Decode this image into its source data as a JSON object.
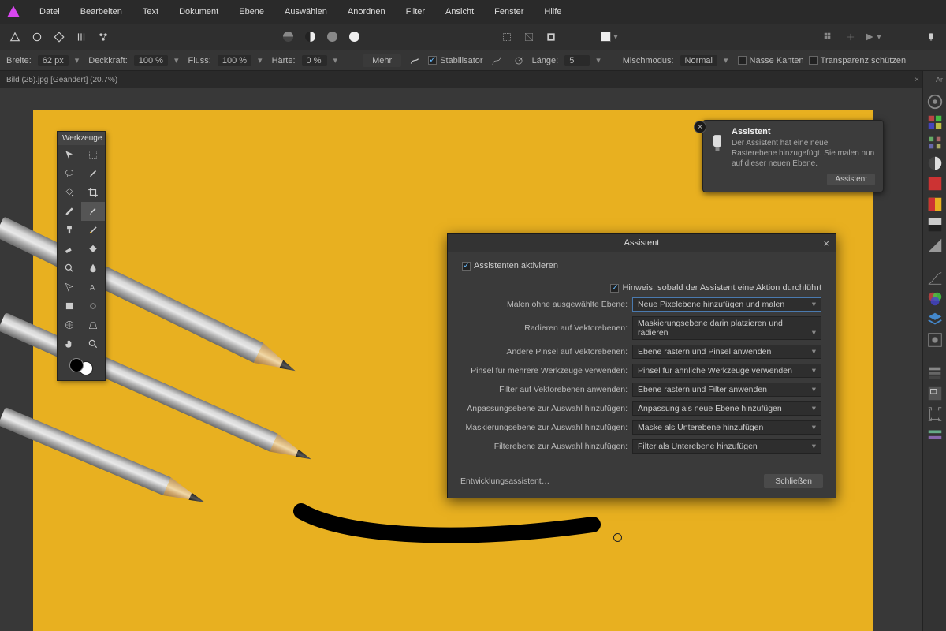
{
  "menubar": {
    "items": [
      "Datei",
      "Bearbeiten",
      "Text",
      "Dokument",
      "Ebene",
      "Auswählen",
      "Anordnen",
      "Filter",
      "Ansicht",
      "Fenster",
      "Hilfe"
    ]
  },
  "optionsbar": {
    "breite_label": "Breite:",
    "breite_value": "62 px",
    "deckkraft_label": "Deckkraft:",
    "deckkraft_value": "100 %",
    "fluss_label": "Fluss:",
    "fluss_value": "100 %",
    "haerte_label": "Härte:",
    "haerte_value": "0 %",
    "mehr_label": "Mehr",
    "stabilisator_label": "Stabilisator",
    "laenge_label": "Länge:",
    "laenge_value": "5",
    "mischmodus_label": "Mischmodus:",
    "mischmodus_value": "Normal",
    "nasse_kanten_label": "Nasse Kanten",
    "transparenz_label": "Transparenz schützen"
  },
  "document": {
    "tab_label": "Bild (25).jpg [Geändert] (20.7%)"
  },
  "tools_panel": {
    "title": "Werkzeuge"
  },
  "notification": {
    "title": "Assistent",
    "body": "Der Assistent hat eine neue Rasterebene hinzugefügt. Sie malen nun auf dieser neuen Ebene.",
    "button": "Assistent"
  },
  "dialog": {
    "title": "Assistent",
    "activate_label": "Assistenten aktivieren",
    "hint_label": "Hinweis, sobald der Assistent eine Aktion durchführt",
    "rows": [
      {
        "label": "Malen ohne ausgewählte Ebene:",
        "value": "Neue Pixelebene hinzufügen und malen",
        "hl": true
      },
      {
        "label": "Radieren auf Vektorebenen:",
        "value": "Maskierungsebene darin platzieren und radieren",
        "hl": false
      },
      {
        "label": "Andere Pinsel auf Vektorebenen:",
        "value": "Ebene rastern und Pinsel anwenden",
        "hl": false
      },
      {
        "label": "Pinsel für mehrere Werkzeuge verwenden:",
        "value": "Pinsel für ähnliche Werkzeuge verwenden",
        "hl": false
      },
      {
        "label": "Filter auf Vektorebenen anwenden:",
        "value": "Ebene rastern und Filter anwenden",
        "hl": false
      },
      {
        "label": "Anpassungsebene zur Auswahl hinzufügen:",
        "value": "Anpassung als neue Ebene hinzufügen",
        "hl": false
      },
      {
        "label": "Maskierungsebene zur Auswahl hinzufügen:",
        "value": "Maske als Unterebene hinzufügen",
        "hl": false
      },
      {
        "label": "Filterebene zur Auswahl hinzufügen:",
        "value": "Filter als Unterebene hinzufügen",
        "hl": false
      }
    ],
    "dev_link": "Entwicklungsassistent…",
    "close_btn": "Schließen"
  },
  "right_tab": "Ar",
  "colors": {
    "canvas_bg": "#e8b020",
    "brush_fg": "#000000"
  }
}
